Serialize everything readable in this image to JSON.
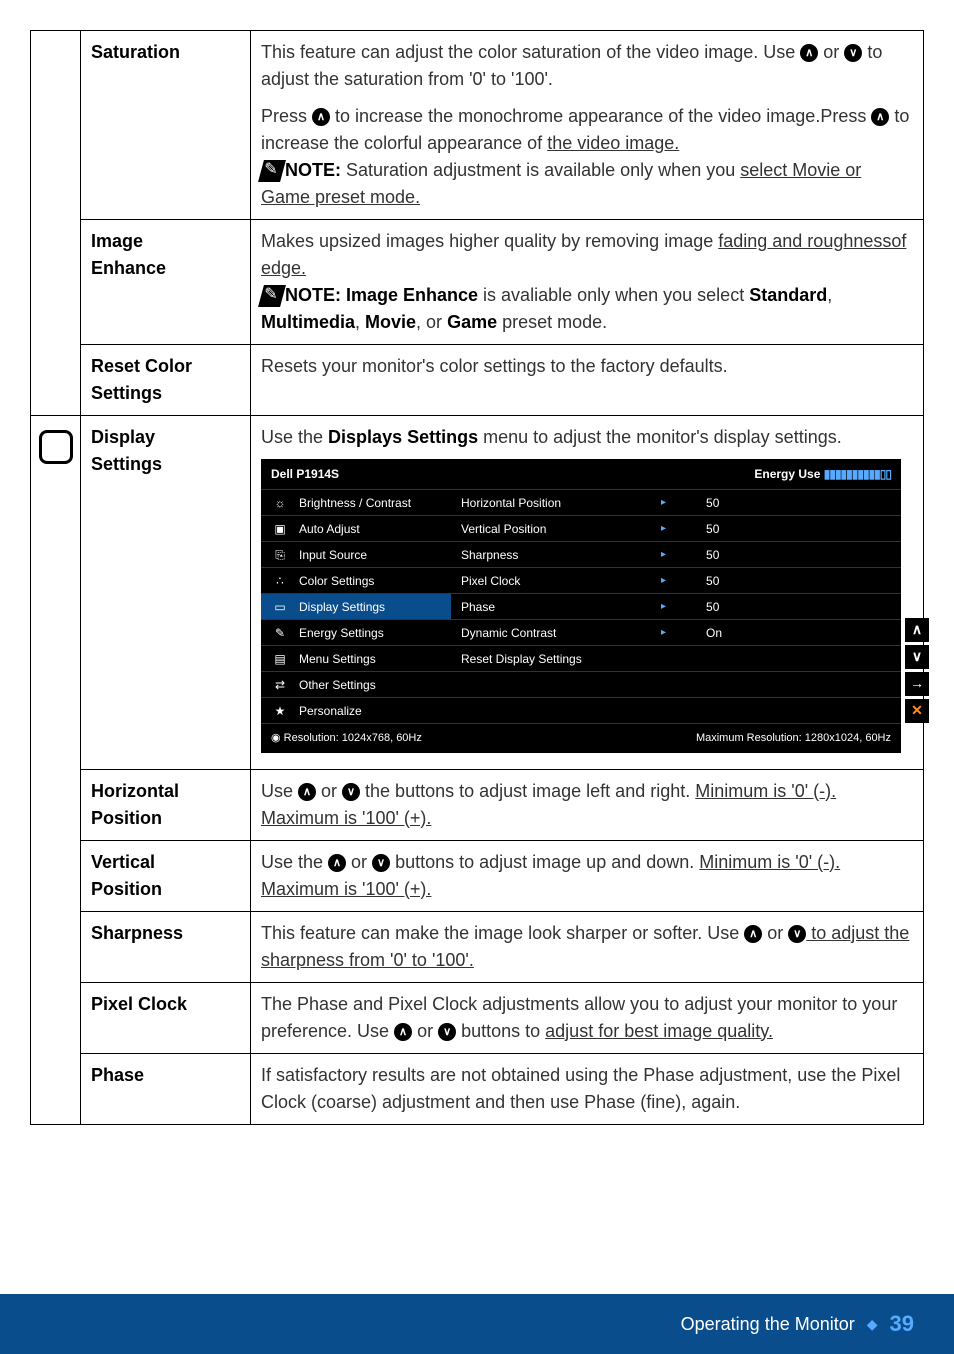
{
  "rows": {
    "saturation": {
      "label": "Saturation",
      "p1a": "This feature can adjust the color saturation of the video image. Use ",
      "p1b": " or ",
      "p1c": " to adjust the saturation from '0' to '100'.",
      "p2a": "Press ",
      "p2b": " to increase the monochrome appearance of the video image.Press ",
      "p2c": " to increase the colorful appearance of ",
      "p2d": "the video image.",
      "note_label": "NOTE:",
      "note_text": " Saturation adjustment is available only when you ",
      "note_tail": "select Movie or Game preset mode."
    },
    "image_enhance": {
      "label1": "Image",
      "label2": "Enhance",
      "p1": "Makes upsized images higher quality by removing image ",
      "p2": "fading and roughnessof edge.",
      "note_label": "NOTE: ",
      "note_bold": "Image Enhance",
      "note_text": " is avaliable only when you select ",
      "note_tail_b1": "Standard",
      "note_tail_c1": ", ",
      "note_tail_b2": "Multimedia",
      "note_tail_c2": ", ",
      "note_tail_b3": "Movie",
      "note_tail_c3": ", or ",
      "note_tail_b4": "Game",
      "note_tail_c4": " preset mode."
    },
    "reset_color": {
      "label1": "Reset Color",
      "label2": "Settings",
      "text": "Resets your monitor's color settings to the factory defaults."
    },
    "display": {
      "label1": "Display",
      "label2": "Settings",
      "text_a": "Use the ",
      "text_b": "Displays Settings",
      "text_c": " menu to adjust the monitor's display settings."
    },
    "horizontal": {
      "label1": "Horizontal",
      "label2": "Position",
      "t1": "Use ",
      "t2": " or ",
      "t3": " the buttons to adjust image left and right. ",
      "t4": "Minimum is '0' (-). Maximum is '100' (+)."
    },
    "vertical": {
      "label1": "Vertical",
      "label2": "Position",
      "t1": " Use the ",
      "t2": " or ",
      "t3": " buttons to adjust image up and down. ",
      "t4": "Minimum is '0' (-). Maximum is '100' (+)."
    },
    "sharpness": {
      "label": "Sharpness",
      "t1": "This feature can make the image look sharper or softer. Use ",
      "t2": " or ",
      "t3": " to adjust the sharpness from '0' to '100'."
    },
    "pixel_clock": {
      "label": "Pixel Clock",
      "t1": "The Phase and Pixel Clock adjustments allow you to adjust your monitor to your preference. Use ",
      "t2": " or ",
      "t3": " buttons to ",
      "t4": "adjust for best image quality."
    },
    "phase": {
      "label": "Phase",
      "t1": "If satisfactory results are not obtained using the Phase adjustment, use the Pixel Clock (coarse) adjustment and then use Phase (fine), again."
    }
  },
  "osd": {
    "title": "Dell P1914S",
    "energy_label": "Energy Use",
    "left_items": [
      {
        "icon": "☼",
        "label": "Brightness / Contrast"
      },
      {
        "icon": "▣",
        "label": "Auto Adjust"
      },
      {
        "icon": "⎘",
        "label": "Input Source"
      },
      {
        "icon": "∴",
        "label": "Color Settings"
      },
      {
        "icon": "▭",
        "label": "Display Settings",
        "highlight": true
      },
      {
        "icon": "✎",
        "label": "Energy Settings"
      },
      {
        "icon": "▤",
        "label": "Menu Settings"
      },
      {
        "icon": "⇄",
        "label": "Other Settings"
      },
      {
        "icon": "★",
        "label": "Personalize"
      }
    ],
    "right_items": [
      {
        "label": "Horizontal Position",
        "arrow": "▸",
        "value": "50"
      },
      {
        "label": "Vertical Position",
        "arrow": "▸",
        "value": "50"
      },
      {
        "label": "Sharpness",
        "arrow": "▸",
        "value": "50"
      },
      {
        "label": "Pixel Clock",
        "arrow": "▸",
        "value": "50"
      },
      {
        "label": "Phase",
        "arrow": "▸",
        "value": "50"
      },
      {
        "label": "Dynamic Contrast",
        "arrow": "▸",
        "value": "On"
      },
      {
        "label": "Reset Display Settings",
        "arrow": "",
        "value": ""
      },
      {
        "label": "",
        "arrow": "",
        "value": ""
      },
      {
        "label": "",
        "arrow": "",
        "value": ""
      }
    ],
    "footer_left_icon": "◉",
    "footer_left": " Resolution: 1024x768, 60Hz",
    "footer_right": "Maximum Resolution: 1280x1024, 60Hz",
    "side_btns": [
      "∧",
      "∨",
      "→",
      "✕"
    ]
  },
  "footer": {
    "section": "Operating the Monitor",
    "page": "39"
  },
  "glyphs": {
    "up": "∧",
    "down": "∨"
  }
}
